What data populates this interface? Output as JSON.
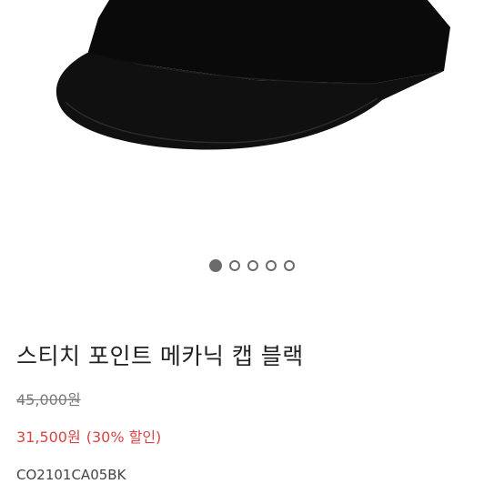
{
  "image": {
    "alt": "black cap"
  },
  "carousel": {
    "total": 5,
    "active_index": 0
  },
  "product": {
    "title": "스티치 포인트 메카닉 캡 블랙",
    "original_price": "45,000원",
    "sale_price": "31,500원",
    "discount": "(30% 할인)",
    "code": "CO2101CA05BK"
  },
  "colors": {
    "sale": "#d64545",
    "cap": "#0d0d0d",
    "dot": "#6b6b6b"
  }
}
